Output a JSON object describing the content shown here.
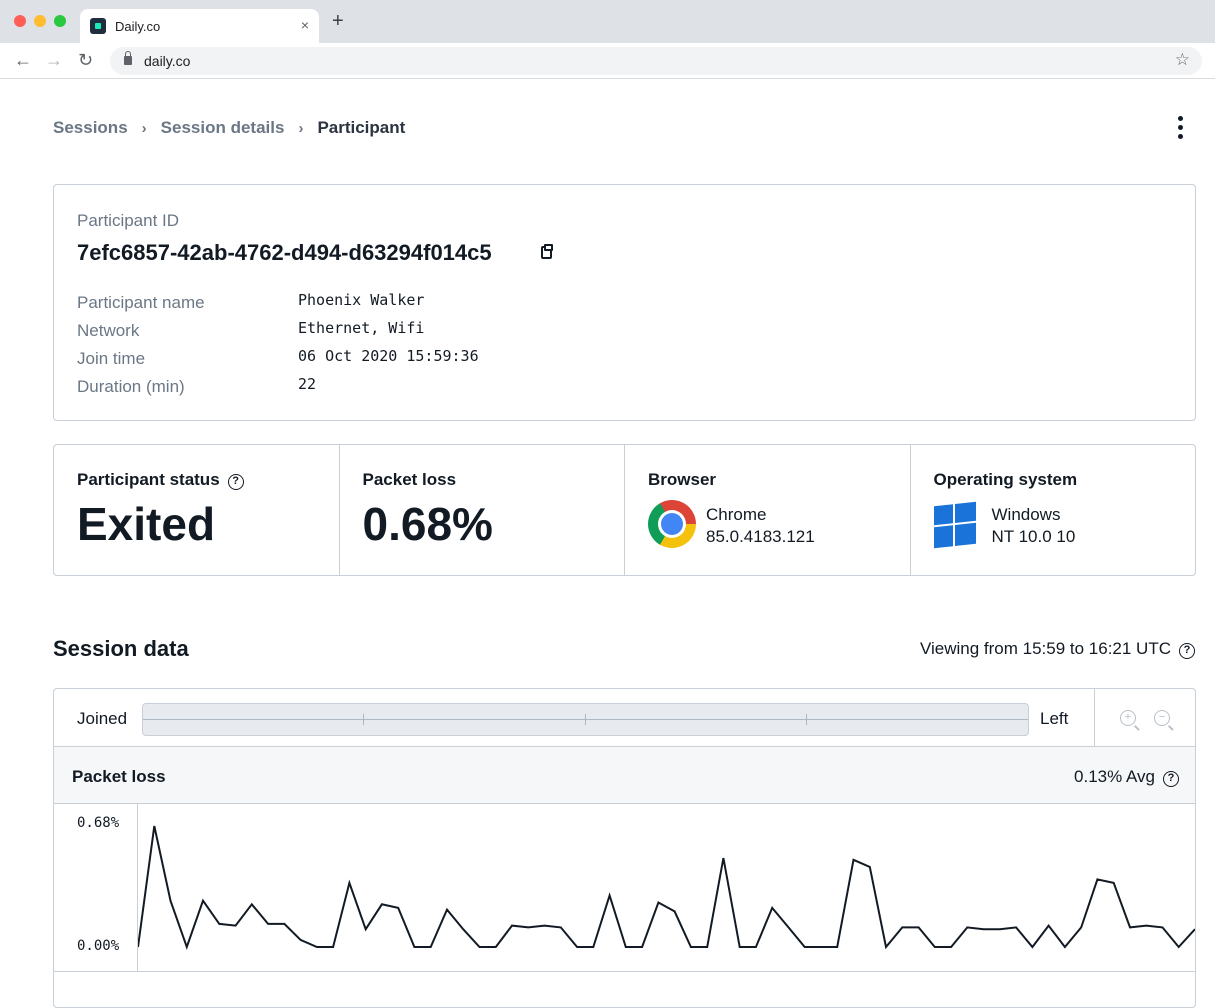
{
  "browser": {
    "tab_title": "Daily.co",
    "tab_close": "×",
    "new_tab": "+",
    "url": "daily.co",
    "back": "←",
    "forward": "→",
    "reload": "↻",
    "star": "☆"
  },
  "breadcrumb": {
    "items": [
      "Sessions",
      "Session details",
      "Participant"
    ],
    "separator": "›"
  },
  "participant": {
    "id_label": "Participant ID",
    "id_value": "7efc6857-42ab-4762-d494-d63294f014c5",
    "rows": [
      {
        "key": "Participant name",
        "value": "Phoenix Walker"
      },
      {
        "key": "Network",
        "value": "Ethernet, Wifi"
      },
      {
        "key": "Join time",
        "value": "06 Oct 2020 15:59:36"
      },
      {
        "key": "Duration (min)",
        "value": "22"
      }
    ]
  },
  "stats": {
    "status": {
      "title": "Participant status",
      "value": "Exited",
      "help": "?"
    },
    "packet_loss": {
      "title": "Packet loss",
      "value": "0.68%"
    },
    "browser": {
      "title": "Browser",
      "name": "Chrome",
      "version": "85.0.4183.121",
      "icon": "chrome-icon"
    },
    "os": {
      "title": "Operating system",
      "name": "Windows",
      "version": "NT 10.0 10",
      "icon": "windows-icon"
    }
  },
  "session": {
    "title": "Session data",
    "viewing": "Viewing from 15:59 to 16:21 UTC",
    "help": "?",
    "timeline": {
      "start_label": "Joined",
      "end_label": "Left"
    },
    "zoom_in": "+",
    "zoom_out": "−",
    "packet_loss_title": "Packet loss",
    "packet_loss_avg": "0.13% Avg"
  },
  "chart_data": {
    "type": "line",
    "title": "Packet loss",
    "y_ticks": [
      "0.68%",
      "0.00%"
    ],
    "ylim": [
      0,
      0.68
    ],
    "series": [
      {
        "values": [
          0.0,
          0.68,
          0.26,
          0.0,
          0.26,
          0.13,
          0.12,
          0.24,
          0.13,
          0.13,
          0.04,
          0.0,
          0.0,
          0.36,
          0.1,
          0.24,
          0.22,
          0.0,
          0.0,
          0.21,
          0.1,
          0.0,
          0.0,
          0.12,
          0.11,
          0.12,
          0.11,
          0.0,
          0.0,
          0.29,
          0.0,
          0.0,
          0.25,
          0.2,
          0.0,
          0.0,
          0.5,
          0.0,
          0.0,
          0.22,
          0.11,
          0.0,
          0.0,
          0.0,
          0.49,
          0.45,
          0.0,
          0.11,
          0.11,
          0.0,
          0.0,
          0.11,
          0.1,
          0.1,
          0.11,
          0.0,
          0.12,
          0.0,
          0.11,
          0.38,
          0.36,
          0.11,
          0.12,
          0.11,
          0.0,
          0.1
        ]
      }
    ],
    "line_color": "#121a24",
    "grid": false
  }
}
